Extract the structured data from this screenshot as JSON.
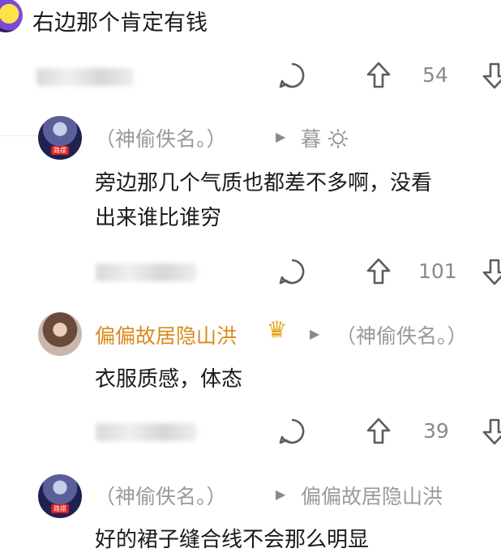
{
  "top_comment": {
    "text": "右边那个肯定有钱",
    "likes": "54"
  },
  "comments": [
    {
      "author": "（神偷佚名。）",
      "reply_to": "暮",
      "text_line1": "旁边那几个气质也都差不多啊，没看",
      "text_line2": "出来谁比谁穷",
      "likes": "101"
    },
    {
      "author": "偏偏故居隐山洪",
      "crown": "♛",
      "reply_to": "（神偷佚名。）",
      "text_line1": "衣服质感，体态",
      "likes": "39"
    },
    {
      "author": "（神偷佚名。）",
      "reply_to": "偏偏故居隐山洪",
      "text_line1": "好的裙子缝合线不会那么明显"
    }
  ],
  "badge": "路摆"
}
